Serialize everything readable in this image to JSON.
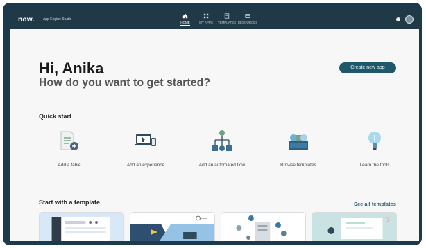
{
  "header": {
    "logo": "now.",
    "app_name": "App Engine Studio",
    "nav": [
      {
        "label": "HOME",
        "icon": "home-icon",
        "active": true
      },
      {
        "label": "MY APPS",
        "icon": "grid-icon",
        "active": false
      },
      {
        "label": "TEMPLATES",
        "icon": "template-icon",
        "active": false
      },
      {
        "label": "RESOURCES",
        "icon": "resources-icon",
        "active": false
      }
    ]
  },
  "hero": {
    "greeting": "Hi, Anika",
    "subtitle": "How do you want to get started?",
    "create_button": "Create new app"
  },
  "quick_start": {
    "title": "Quick start",
    "items": [
      {
        "label": "Add a table",
        "icon": "table-add-icon"
      },
      {
        "label": "Add an experience",
        "icon": "devices-icon"
      },
      {
        "label": "Add an automated flow",
        "icon": "flow-icon"
      },
      {
        "label": "Browse templates",
        "icon": "templates-icon"
      },
      {
        "label": "Learn the tools",
        "icon": "lightbulb-icon"
      }
    ]
  },
  "templates": {
    "title": "Start with a template",
    "see_all": "See all templates"
  },
  "colors": {
    "frame": "#1c3a4b",
    "topbar": "#203947",
    "accent": "#20586b",
    "link": "#1f5f7a"
  }
}
